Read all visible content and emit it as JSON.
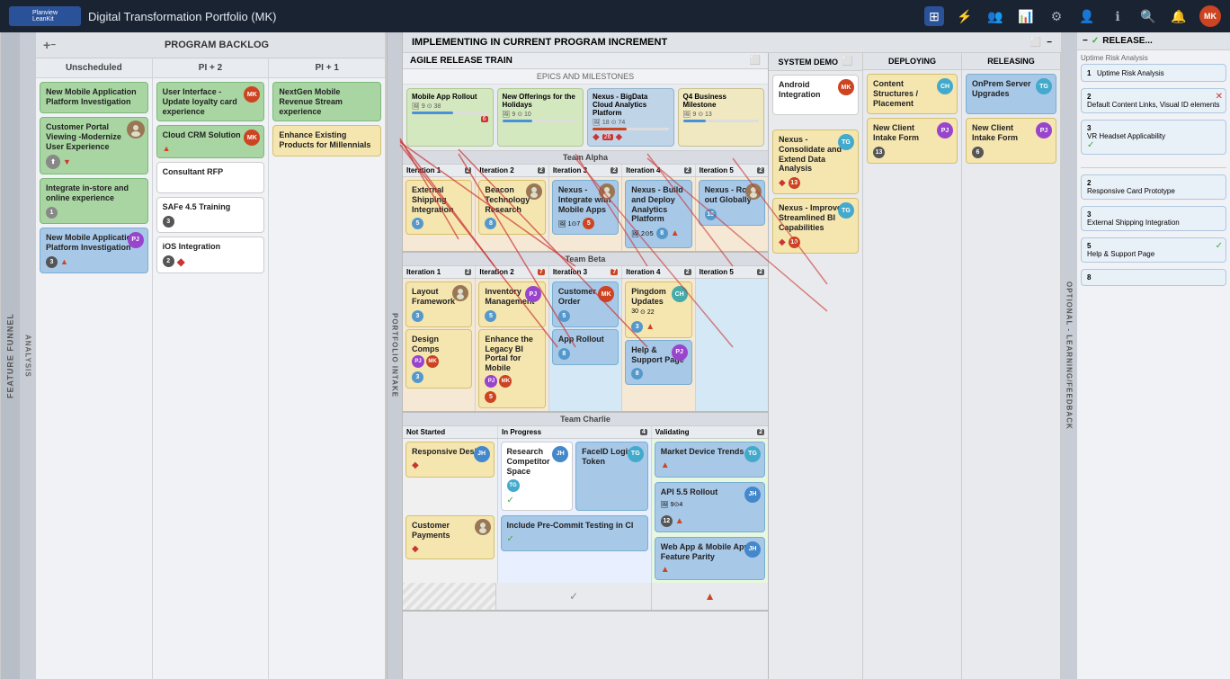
{
  "app": {
    "title": "Digital Transformation Portfolio (MK)"
  },
  "topbar": {
    "logo": "Planview LeanKit",
    "icons": [
      "board-icon",
      "filter-icon",
      "users-icon",
      "chart-icon",
      "settings-icon",
      "person-icon",
      "info-icon",
      "search-icon",
      "notifications-icon",
      "avatar-icon"
    ]
  },
  "programBacklog": {
    "title": "PROGRAM BACKLOG",
    "columns": [
      "Unscheduled",
      "PI + 2",
      "PI + 1"
    ]
  },
  "implementingLabel": "IMPLEMENTING IN CURRENT PROGRAM INCREMENT",
  "artLabel": "AGILE RELEASE TRAIN",
  "epicsLabel": "EPICS AND MILESTONES",
  "systemDemo": "SYSTEM DEMO",
  "deploying": "DEPLOYING",
  "releasing": "RELEASING",
  "releaseTitle": "RELEASE...",
  "featureFunnel": "FEATURE FUNNEL",
  "analysis": "ANALYSIS",
  "portfolioIntake": "PORTFOLIO INTAKE",
  "optionalLearning": "OPTIONAL - LEARNING/FEEDBACK",
  "colors": {
    "green": "#a8d5a2",
    "blue": "#a8c8e8",
    "yellow": "#f5e6b0",
    "purple": "#d4b8e0",
    "orange": "#f5d0a0",
    "teal": "#a0d0c8",
    "white": "#ffffff",
    "pink": "#f0c8c8"
  },
  "unscheduled": {
    "cards": [
      {
        "title": "New Mobile Application Platform Investigation",
        "color": "green",
        "avatar": null
      },
      {
        "title": "Customer Portal Viewing -Modernize User Experience",
        "color": "green",
        "avatar": "photo"
      },
      {
        "title": "Integrate in-store and online experience",
        "color": "green",
        "avatar": null
      },
      {
        "title": "New Mobile Application Platform Investigation",
        "color": "blue",
        "avatar": "PJ"
      }
    ]
  },
  "pi2": {
    "cards": [
      {
        "title": "User Interface - Update loyalty card experience",
        "color": "green",
        "avatar": "MK"
      },
      {
        "title": "Cloud CRM Solution",
        "color": "green",
        "avatar": "MK"
      },
      {
        "title": "Consultant RFP",
        "color": "white",
        "avatar": null
      },
      {
        "title": "SAFe 4.5 Training",
        "color": "white",
        "avatar": null
      },
      {
        "title": "iOS Integration",
        "color": "white",
        "avatar": null
      }
    ]
  },
  "pi1": {
    "cards": [
      {
        "title": "NextGen Mobile Revenue Stream experience",
        "color": "green",
        "avatar": null
      },
      {
        "title": "Enhance Existing Products for Millennials",
        "color": "yellow",
        "avatar": null
      }
    ]
  },
  "teams": {
    "alpha": "Team Alpha",
    "beta": "Team Beta",
    "charlie": "Team Charlie"
  },
  "iterations": [
    "Iteration 1",
    "Iteration 2",
    "Iteration 3",
    "Iteration 4",
    "Iteration 5"
  ],
  "alphaCards": {
    "iter1": [
      {
        "title": "External Shipping Integration",
        "color": "yellow"
      }
    ],
    "iter2": [
      {
        "title": "Beacon Technology Research",
        "color": "yellow"
      }
    ],
    "iter3": [
      {
        "title": "Nexus - Integrate with Mobile Apps",
        "color": "blue"
      }
    ],
    "iter4": [
      {
        "title": "Nexus - Build and Deploy Analytics Platform",
        "color": "blue"
      }
    ],
    "iter5": [
      {
        "title": "Nexus - Roll-out Globally",
        "color": "blue"
      }
    ]
  },
  "betaCards": {
    "iter1": [
      {
        "title": "Layout Framework",
        "color": "yellow"
      },
      {
        "title": "Design Comps",
        "color": "yellow"
      }
    ],
    "iter2": [
      {
        "title": "Inventory Management",
        "color": "yellow"
      },
      {
        "title": "Enhance the Legacy BI Portal for Mobile",
        "color": "yellow"
      }
    ],
    "iter3": [
      {
        "title": "Customer Order",
        "color": "blue"
      },
      {
        "title": "App Rollout",
        "color": "blue"
      }
    ],
    "iter4": [
      {
        "title": "Pingdom Updates",
        "color": "yellow"
      },
      {
        "title": "Help & Support Page",
        "color": "blue"
      }
    ],
    "iter5": []
  },
  "charlieCards": {
    "notStarted": [
      {
        "title": "Responsive Design",
        "color": "yellow"
      },
      {
        "title": "Customer Payments",
        "color": "yellow"
      }
    ],
    "inProgress": [
      {
        "title": "Research Competitor Space",
        "color": "white"
      },
      {
        "title": "FaceID Login Token",
        "color": "blue"
      },
      {
        "title": "Include Pre-Commit Testing in CI",
        "color": "blue"
      }
    ],
    "validating": [
      {
        "title": "Market Device Trends",
        "color": "blue"
      },
      {
        "title": "API 5.5 Rollout",
        "color": "blue"
      },
      {
        "title": "Web App & Mobile App Feature Parity",
        "color": "blue"
      }
    ]
  },
  "systemDemoCards": [
    {
      "title": "Android Integration",
      "color": "white",
      "avatar": "MK"
    },
    {
      "title": "Nexus - Consolidate and Extend Data Analysis",
      "color": "yellow",
      "avatar": "TG"
    },
    {
      "title": "Nexus - Improve Streamlined BI Capabilities",
      "color": "yellow",
      "avatar": "TG"
    }
  ],
  "deployingCards": [
    {
      "title": "Content Structures / Placement",
      "color": "yellow",
      "avatar": "CH"
    },
    {
      "title": "New Client Intake Form",
      "color": "yellow",
      "avatar": "PJ"
    }
  ],
  "releasingCards": [
    {
      "title": "OnPrem Server Upgrades",
      "color": "blue",
      "avatar": "TG"
    },
    {
      "title": "New Client Intake Form",
      "color": "yellow",
      "avatar": "PJ"
    }
  ],
  "releaseItems": [
    {
      "num": "1",
      "title": "Uptime Risk Analysis"
    },
    {
      "num": "2",
      "title": "Default Content Links, Visual ID elements"
    },
    {
      "num": "3",
      "title": "VR Headset Applicability"
    },
    {
      "num": "2",
      "title": "Responsive Card Prototype"
    },
    {
      "num": "3",
      "title": "External Shipping Integration"
    },
    {
      "num": "5",
      "title": "Help & Support Page"
    },
    {
      "num": "8",
      "title": ""
    }
  ],
  "epicsRow": [
    {
      "title": "Mobile App Rollout",
      "color": "green"
    },
    {
      "title": "New Offerings for the Holidays",
      "color": "green"
    },
    {
      "title": "Nexus - BigData Cloud Analytics Platform",
      "color": "blue"
    },
    {
      "title": "Q4 Business Milestone",
      "color": "yellow"
    }
  ]
}
